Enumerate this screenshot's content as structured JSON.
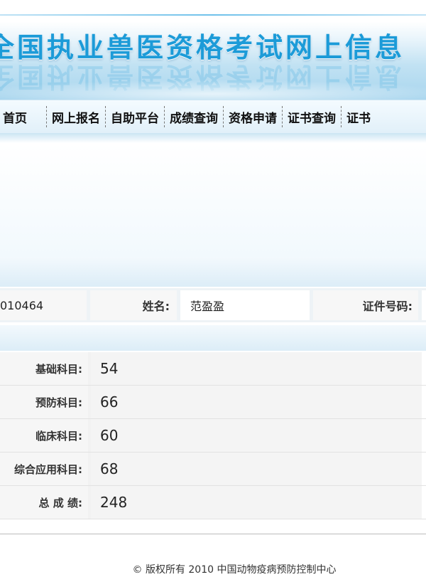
{
  "header": {
    "title": "全国执业兽医资格考试网上信息"
  },
  "nav": {
    "items": [
      {
        "label": "首页"
      },
      {
        "label": "网上报名"
      },
      {
        "label": "自助平台"
      },
      {
        "label": "成绩查询"
      },
      {
        "label": "资格申请"
      },
      {
        "label": "证书查询"
      },
      {
        "label": "证书"
      }
    ]
  },
  "candidate": {
    "id_partial": "010464",
    "name_label": "姓名:",
    "name_value": "范盈盈",
    "cert_label": "证件号码:"
  },
  "scores": [
    {
      "label": "基础科目:",
      "value": "54"
    },
    {
      "label": "预防科目:",
      "value": "66"
    },
    {
      "label": "临床科目:",
      "value": "60"
    },
    {
      "label": "综合应用科目:",
      "value": "68"
    },
    {
      "label": "总 成 绩:",
      "value": "248"
    }
  ],
  "footer": {
    "copyright_symbol": "©",
    "text": "版权所有 2010 中国动物疫病预防控制中心"
  },
  "colors": {
    "accent": "#1c9bd8",
    "banner_bg": "#a7d5ee",
    "nav_bg": "#e1f0f9"
  }
}
